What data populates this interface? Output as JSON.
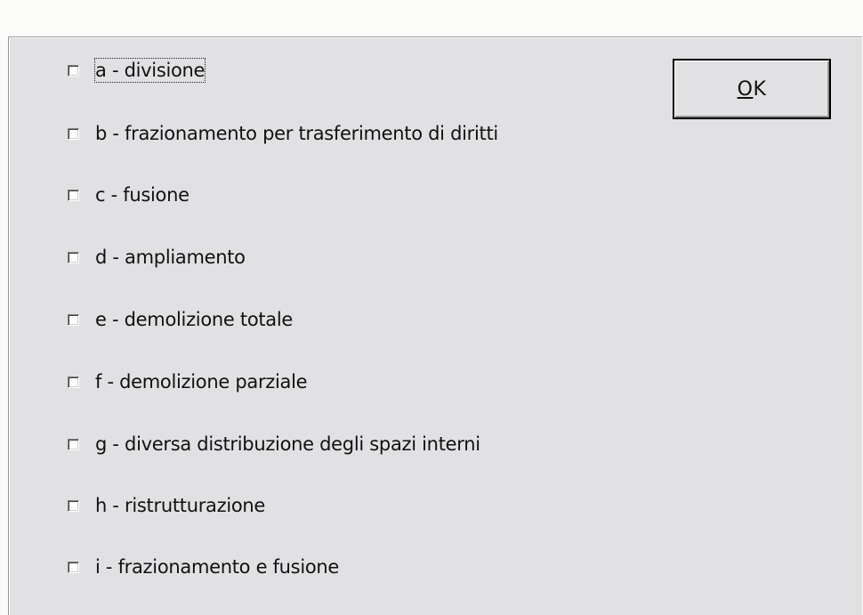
{
  "dialog": {
    "options": [
      {
        "label": "a - divisione",
        "checked": false,
        "focused": true
      },
      {
        "label": "b - frazionamento per trasferimento di diritti",
        "checked": false
      },
      {
        "label": "c - fusione",
        "checked": false
      },
      {
        "label": "d - ampliamento",
        "checked": false
      },
      {
        "label": "e - demolizione totale",
        "checked": false
      },
      {
        "label": "f - demolizione parziale",
        "checked": false
      },
      {
        "label": "g - diversa distribuzione degli spazi interni",
        "checked": false
      },
      {
        "label": "h - ristrutturazione",
        "checked": false
      },
      {
        "label": "i - frazionamento e fusione",
        "checked": false
      }
    ],
    "ok_button": {
      "mnemonic": "O",
      "rest": "K"
    }
  }
}
